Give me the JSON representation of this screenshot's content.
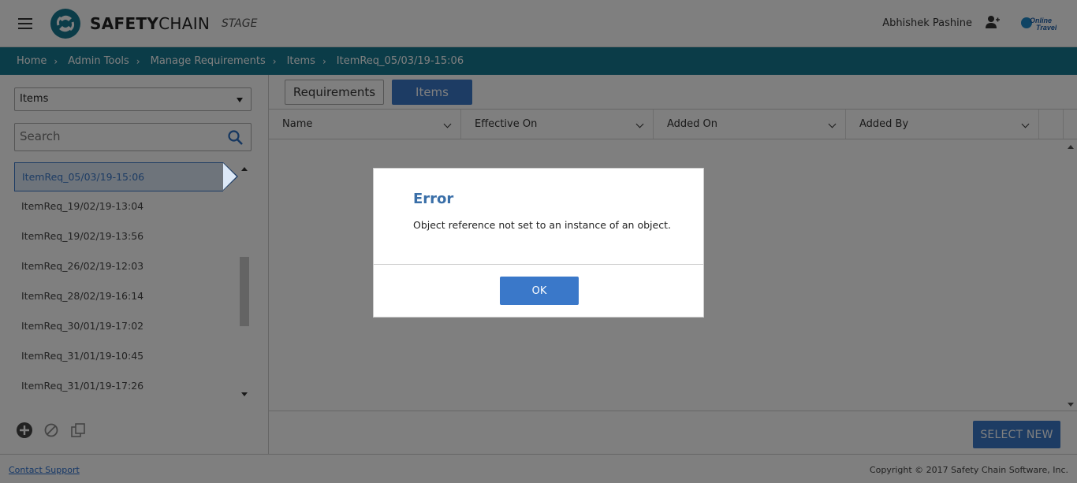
{
  "header": {
    "brand_bold": "SAFETY",
    "brand_light": "CHAIN",
    "environment": "STAGE",
    "user_name": "Abhishek Pashine",
    "badge_line1": "Online",
    "badge_line2": "Travel",
    "icons": {
      "menu": "hamburger-icon",
      "user": "user-settings-icon"
    }
  },
  "breadcrumb": [
    "Home",
    "Admin Tools",
    "Manage Requirements",
    "Items",
    "ItemReq_05/03/19-15:06"
  ],
  "left_panel": {
    "type_select": "Items",
    "search_placeholder": "Search",
    "items": [
      "ItemReq_05/03/19-15:06",
      "ItemReq_19/02/19-13:04",
      "ItemReq_19/02/19-13:56",
      "ItemReq_26/02/19-12:03",
      "ItemReq_28/02/19-16:14",
      "ItemReq_30/01/19-17:02",
      "ItemReq_31/01/19-10:45",
      "ItemReq_31/01/19-17:26"
    ],
    "selected_index": 0,
    "actions": [
      "add-icon",
      "disable-icon",
      "copy-icon"
    ]
  },
  "right_panel": {
    "tabs": [
      "Requirements",
      "Items"
    ],
    "active_tab": "Items",
    "columns": [
      "Name",
      "Effective On",
      "Added On",
      "Added By"
    ],
    "select_new_label": "SELECT NEW"
  },
  "footer": {
    "contact": "Contact Support",
    "copyright": "Copyright © 2017 Safety Chain Software, Inc."
  },
  "dialog": {
    "title": "Error",
    "message": "Object reference not set to an instance of an object.",
    "ok_label": "OK"
  },
  "colors": {
    "teal": "#177891",
    "primary": "#3a78c9",
    "dialog_title": "#3a6fa8"
  }
}
